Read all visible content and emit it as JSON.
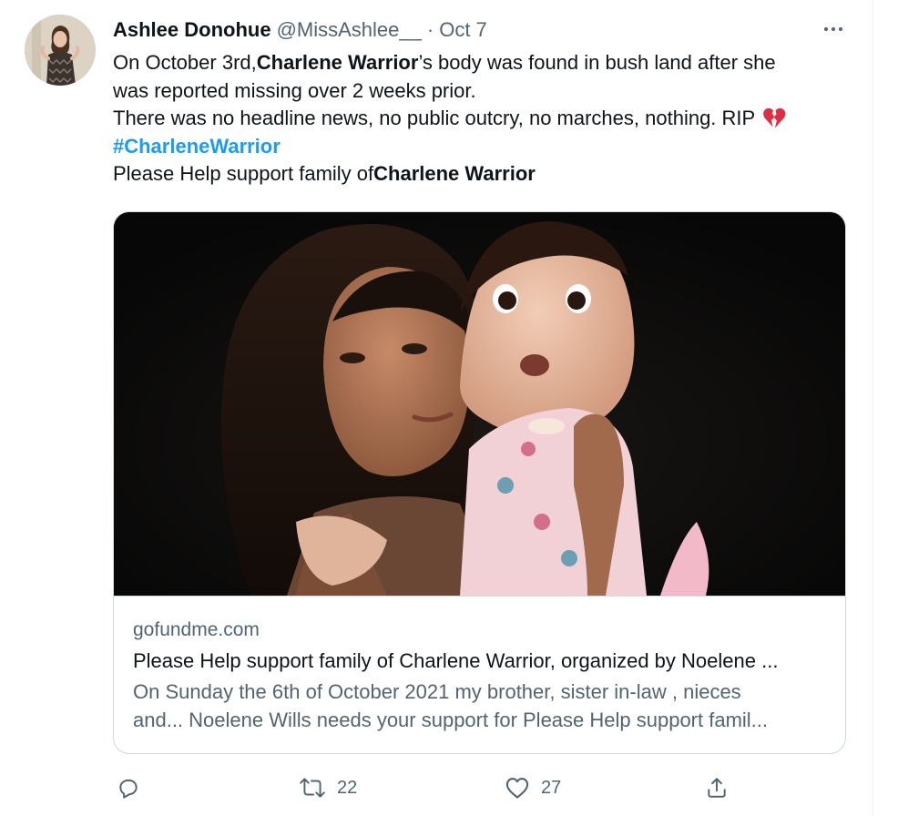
{
  "tweet": {
    "author_name": "Ashlee Donohue",
    "author_handle": "@MissAshlee__",
    "separator": "·",
    "date": "Oct 7",
    "text_lines": [
      {
        "pre": "On October 3rd, ",
        "bold": "Charlene Warrior",
        "post": "’s body was found in bush land after she"
      },
      {
        "plain": "was reported missing over 2 weeks prior."
      },
      {
        "plain": "There was no headline news, no public outcry, no marches, nothing. RIP",
        "emoji": "broken-heart-icon"
      },
      {
        "hashtag": "#CharleneWarrior"
      },
      {
        "pre": "Please Help support family of ",
        "bold": "Charlene Warrior"
      }
    ]
  },
  "card": {
    "domain": "gofundme.com",
    "title": "Please Help support family of Charlene Warrior, organized by Noelene ...",
    "description_lines": [
      "On Sunday the 6th of October 2021 my brother, sister in-law , nieces",
      "and... Noelene Wills needs your support for Please Help support famil..."
    ]
  },
  "actions": {
    "reply": {
      "icon": "reply-icon"
    },
    "retweet": {
      "icon": "retweet-icon",
      "count": "22"
    },
    "like": {
      "icon": "like-icon",
      "count": "27"
    },
    "share": {
      "icon": "share-icon"
    }
  },
  "colors": {
    "accent": "#1d9bf0",
    "secondary_text": "#536471",
    "border": "#cfd9de",
    "emoji_red": "#dd2e44"
  }
}
